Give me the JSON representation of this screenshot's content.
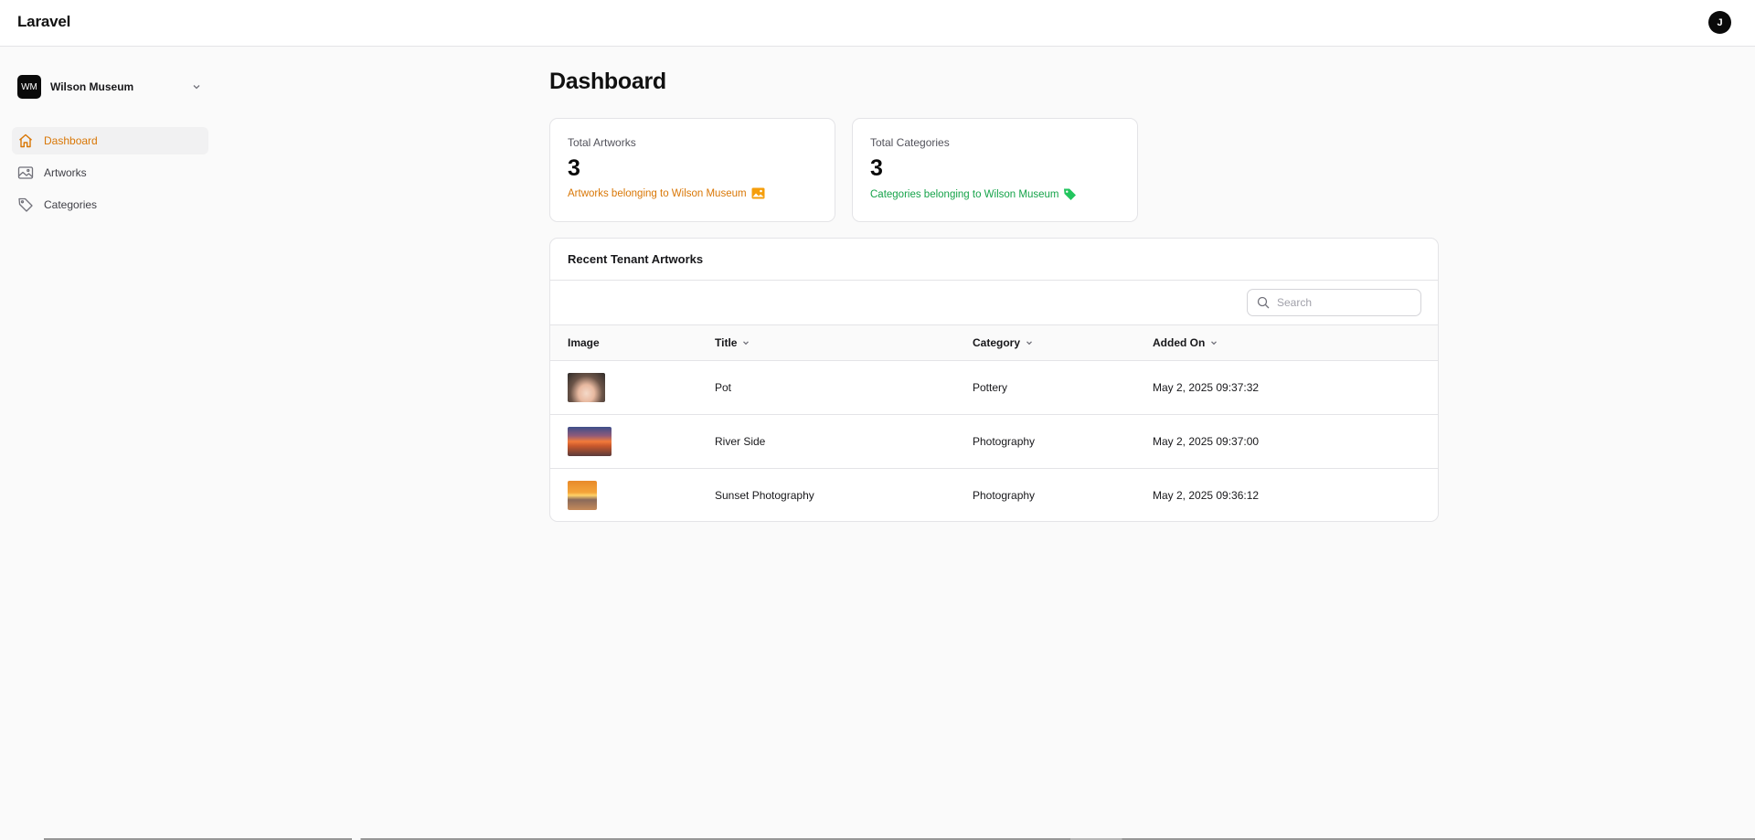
{
  "app": {
    "brand": "Laravel",
    "user_initial": "J"
  },
  "tenant": {
    "initials": "WM",
    "name": "Wilson Museum"
  },
  "sidebar": {
    "items": [
      {
        "label": "Dashboard",
        "icon": "home-icon",
        "active": true
      },
      {
        "label": "Artworks",
        "icon": "image-icon",
        "active": false
      },
      {
        "label": "Categories",
        "icon": "tag-icon",
        "active": false
      }
    ]
  },
  "page": {
    "title": "Dashboard"
  },
  "stats": {
    "artworks": {
      "label": "Total Artworks",
      "value": "3",
      "description": "Artworks belonging to Wilson Museum",
      "icon": "photo-icon",
      "color": "#d97706"
    },
    "categories": {
      "label": "Total Categories",
      "value": "3",
      "description": "Categories belonging to Wilson Museum",
      "icon": "tag-icon",
      "color": "#16a34a"
    }
  },
  "table": {
    "title": "Recent Tenant Artworks",
    "search_placeholder": "Search",
    "columns": [
      {
        "label": "Image",
        "sortable": false
      },
      {
        "label": "Title",
        "sortable": true
      },
      {
        "label": "Category",
        "sortable": true
      },
      {
        "label": "Added On",
        "sortable": true
      }
    ],
    "rows": [
      {
        "image": "pot-thumbnail",
        "title": "Pot",
        "category": "Pottery",
        "added_on": "May 2, 2025 09:37:32"
      },
      {
        "image": "river-side-thumbnail",
        "title": "River Side",
        "category": "Photography",
        "added_on": "May 2, 2025 09:37:00"
      },
      {
        "image": "sunset-photography-thumbnail",
        "title": "Sunset Photography",
        "category": "Photography",
        "added_on": "May 2, 2025 09:36:12"
      }
    ]
  },
  "colors": {
    "accent": "#d97706",
    "success": "#16a34a"
  }
}
